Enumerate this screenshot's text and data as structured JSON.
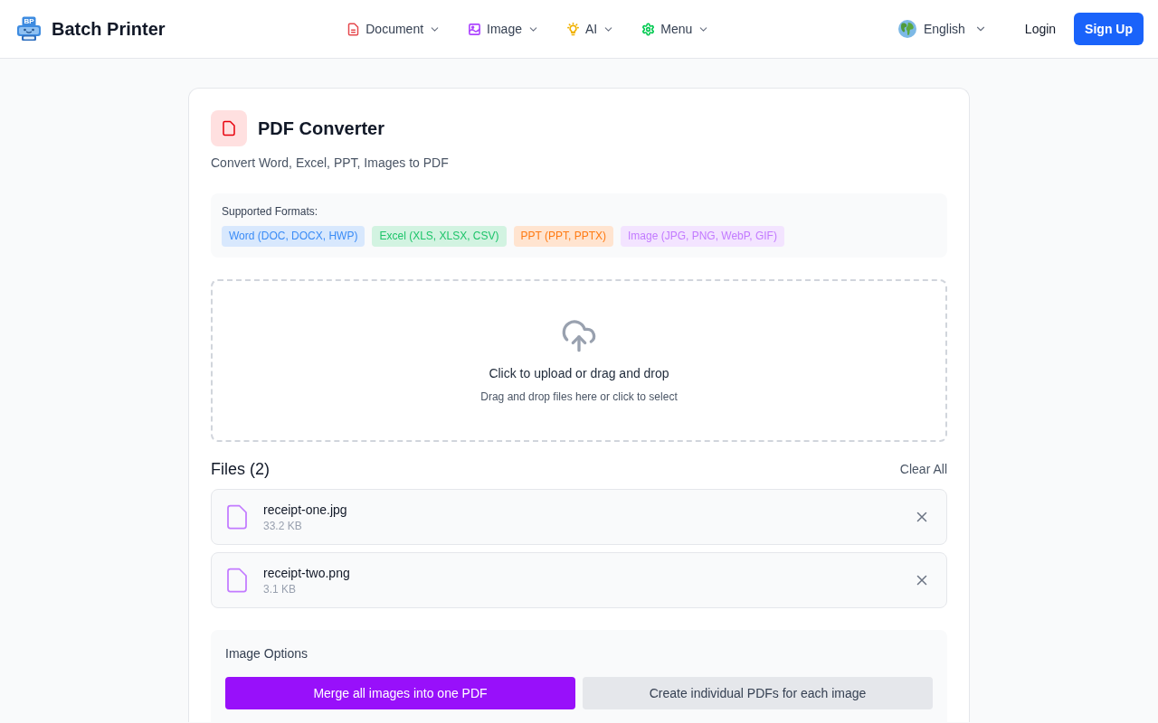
{
  "header": {
    "logo_text": "BP",
    "brand": "Batch Printer",
    "nav": [
      {
        "label": "Document",
        "color": "#e5484d"
      },
      {
        "label": "Image",
        "color": "#ad46ff"
      },
      {
        "label": "AI",
        "color": "#f0b100"
      },
      {
        "label": "Menu",
        "color": "#00c950"
      }
    ],
    "language": "English",
    "login": "Login",
    "signup": "Sign Up"
  },
  "converter": {
    "title": "PDF Converter",
    "subtitle": "Convert Word, Excel, PPT, Images to PDF",
    "formats": {
      "label": "Supported Formats:",
      "tags": [
        {
          "label": "Word (DOC, DOCX, HWP)",
          "color": "#3b8cf6"
        },
        {
          "label": "Excel (XLS, XLSX, CSV)",
          "color": "#1ec46a"
        },
        {
          "label": "PPT (PPT, PPTX)",
          "color": "#ff7a12"
        },
        {
          "label": "Image (JPG, PNG, WebP, GIF)",
          "color": "#c27aff"
        }
      ]
    },
    "dropzone": {
      "title": "Click to upload or drag and drop",
      "hint": "Drag and drop files here or click to select"
    },
    "files": {
      "heading": "Files (2)",
      "clear": "Clear All",
      "items": [
        {
          "name": "receipt-one.jpg",
          "size": "33.2 KB"
        },
        {
          "name": "receipt-two.png",
          "size": "3.1 KB"
        }
      ]
    },
    "image_options": {
      "label": "Image Options",
      "choices": [
        {
          "label": "Merge all images into one PDF",
          "selected": true
        },
        {
          "label": "Create individual PDFs for each image",
          "selected": false
        }
      ]
    }
  }
}
